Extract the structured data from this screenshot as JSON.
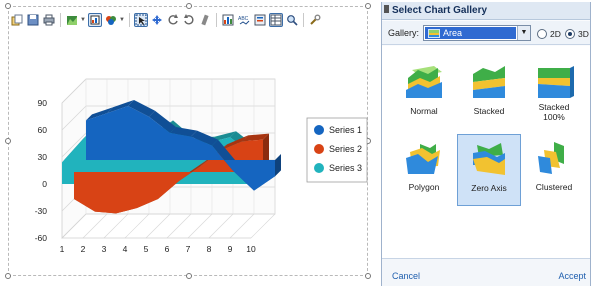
{
  "toolbar": {
    "buttons": [
      {
        "name": "copy-icon"
      },
      {
        "name": "save-icon"
      },
      {
        "name": "print-icon"
      },
      {
        "name": "chart-type-icon"
      },
      {
        "name": "palette-icon"
      },
      {
        "name": "series-color-icon"
      },
      {
        "name": "selection-icon"
      },
      {
        "name": "move-icon"
      },
      {
        "name": "rotate-left-icon"
      },
      {
        "name": "rotate-right-icon"
      },
      {
        "name": "zoom-out-icon"
      },
      {
        "name": "data-editor-icon"
      },
      {
        "name": "text-abc-icon"
      },
      {
        "name": "legend-icon"
      },
      {
        "name": "data-grid-icon"
      },
      {
        "name": "zoom-icon"
      },
      {
        "name": "tools-icon"
      }
    ]
  },
  "chart_data": {
    "type": "area",
    "three_d": true,
    "categories": [
      "1",
      "2",
      "3",
      "4",
      "5",
      "6",
      "7",
      "8",
      "9",
      "10"
    ],
    "y_ticks": [
      "90",
      "60",
      "30",
      "0",
      "-30",
      "-60"
    ],
    "ylim": [
      -60,
      90
    ],
    "grid": true,
    "legend_position": "right",
    "series": [
      {
        "name": "Series 1",
        "color": "#1565c0",
        "values": [
          44,
          52,
          60,
          48,
          30,
          26,
          16,
          -12,
          -34,
          -18
        ]
      },
      {
        "name": "Series 2",
        "color": "#d84315",
        "values": [
          -30,
          -44,
          -46,
          -40,
          -30,
          -10,
          6,
          24,
          34,
          36
        ]
      },
      {
        "name": "Series 3",
        "color": "#21b3bd",
        "values": [
          24,
          50,
          72,
          58,
          48,
          64,
          44,
          46,
          52,
          34
        ]
      }
    ]
  },
  "gallery": {
    "title": "Select Chart Gallery",
    "label": "Gallery:",
    "selected_gallery": "Area",
    "radio_2d": "2D",
    "radio_3d": "3D",
    "view_mode": "3D",
    "items": [
      {
        "label": "Normal"
      },
      {
        "label": "Stacked"
      },
      {
        "label": "Stacked\n100%"
      },
      {
        "label": "Polygon"
      },
      {
        "label": "Zero Axis"
      },
      {
        "label": "Clustered"
      }
    ],
    "selected_item": "Zero Axis",
    "cancel": "Cancel",
    "accept": "Accept"
  }
}
